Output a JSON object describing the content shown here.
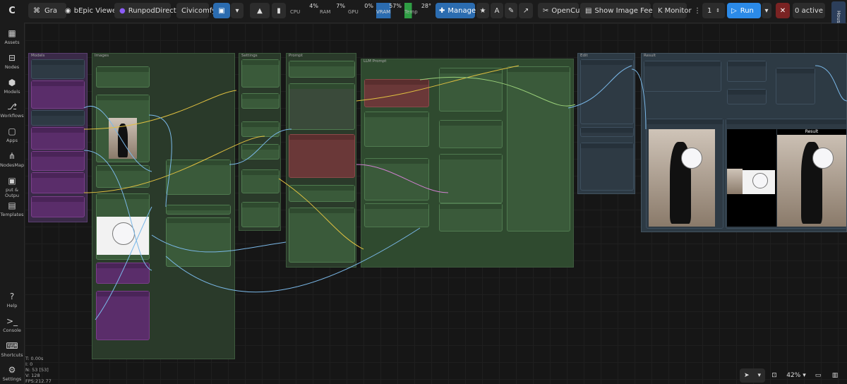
{
  "topbar": {
    "tab_title": "Gra",
    "viewer_label": "bEpic Viewer",
    "runpod_label": "RunpodDirect",
    "civicomfy_label": "Civicomfy",
    "cpu": {
      "label": "CPU",
      "value": "4%"
    },
    "ram": {
      "label": "RAM",
      "value": "7%"
    },
    "gpu": {
      "label": "GPU",
      "value": "0%"
    },
    "vram": {
      "label": "VRAM",
      "value": "57%"
    },
    "temp": {
      "label": "Temp",
      "value": "28°"
    },
    "manager_label": "Manager",
    "opencut_label": "OpenCut",
    "show_image_feed_label": "Show Image Feed",
    "monitor_label": "Monitor",
    "queue_count": "1",
    "run_label": "Run",
    "active_label": "0 active",
    "housekeeper_label": "Housekeeper"
  },
  "sidebar": {
    "items": [
      {
        "label": "Assets",
        "icon": "assets-icon"
      },
      {
        "label": "Nodes",
        "icon": "nodes-icon"
      },
      {
        "label": "Models",
        "icon": "models-icon"
      },
      {
        "label": "Workflows",
        "icon": "workflows-icon"
      },
      {
        "label": "Apps",
        "icon": "apps-icon"
      },
      {
        "label": "NodesMap",
        "icon": "nodesmap-icon"
      },
      {
        "label": "put & Outpu",
        "icon": "io-icon"
      },
      {
        "label": "Templates",
        "icon": "templates-icon"
      }
    ],
    "bottom": [
      {
        "label": "Help",
        "icon": "help-icon"
      },
      {
        "label": "Console",
        "icon": "console-icon"
      },
      {
        "label": "Shortcuts",
        "icon": "keyboard-icon"
      },
      {
        "label": "Settings",
        "icon": "gear-icon"
      }
    ]
  },
  "stats": {
    "t": "T: 0.00s",
    "i": "I: 0",
    "n": "N: 53 [53]",
    "v": "V: 128",
    "fps": "FPS:212.77"
  },
  "groups": {
    "models": "Models",
    "images": "Images",
    "settings": "Settings",
    "prompt": "Prompt",
    "llm_prompt": "LLM Prompt",
    "edit": "Edit",
    "result": "Result",
    "result_label": "Result"
  },
  "zoom": "42%"
}
